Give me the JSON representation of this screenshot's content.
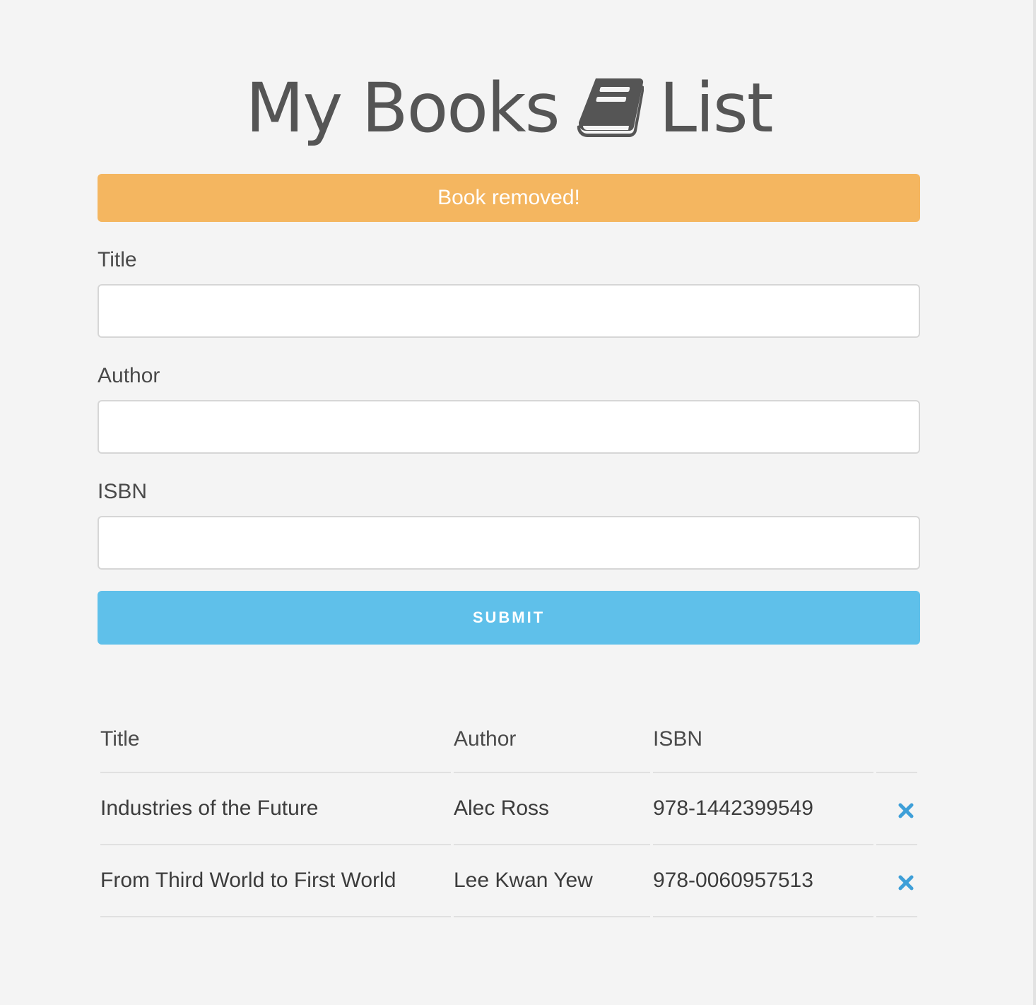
{
  "header": {
    "title_left": "My Books",
    "title_right": "List",
    "icon": "book-icon"
  },
  "alert": {
    "message": "Book removed!",
    "color": "#f4b660"
  },
  "form": {
    "title_label": "Title",
    "title_value": "",
    "author_label": "Author",
    "author_value": "",
    "isbn_label": "ISBN",
    "isbn_value": "",
    "submit_label": "SUBMIT",
    "submit_color": "#5fc0ea"
  },
  "table": {
    "headers": {
      "title": "Title",
      "author": "Author",
      "isbn": "ISBN"
    },
    "rows": [
      {
        "title": "Industries of the Future",
        "author": "Alec Ross",
        "isbn": "978-1442399549"
      },
      {
        "title": "From Third World to First World",
        "author": "Lee Kwan Yew",
        "isbn": "978-0060957513"
      }
    ],
    "delete_icon": "close-icon",
    "delete_color": "#3e9fd8"
  }
}
